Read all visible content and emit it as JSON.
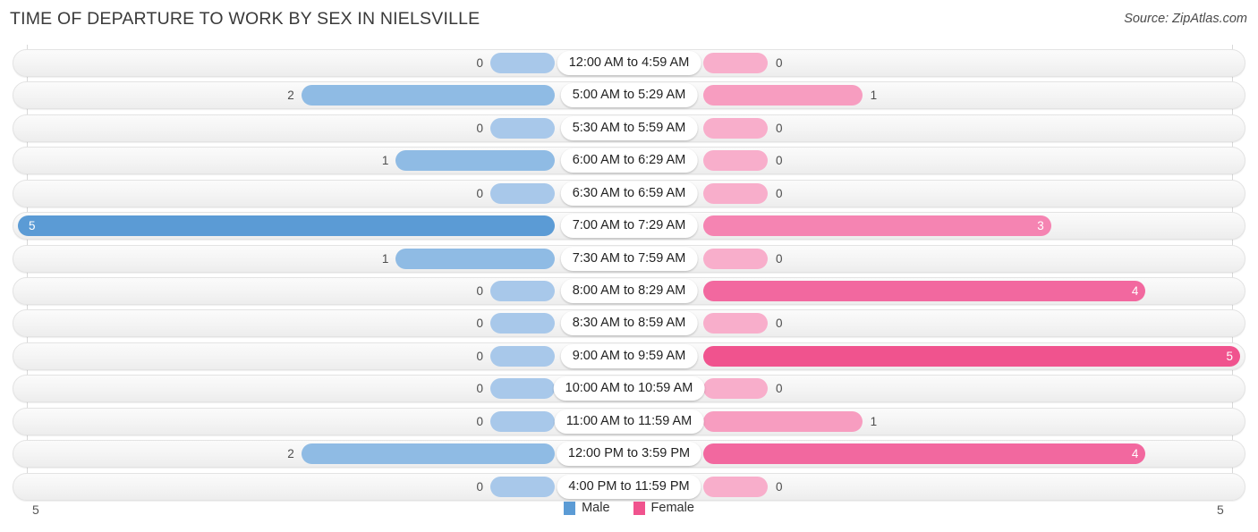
{
  "header": {
    "title": "TIME OF DEPARTURE TO WORK BY SEX IN NIELSVILLE",
    "source": "Source: ZipAtlas.com"
  },
  "axis": {
    "left_label": "5",
    "right_label": "5"
  },
  "legend": {
    "items": [
      {
        "label": "Male",
        "color": "#5b9bd5"
      },
      {
        "label": "Female",
        "color": "#f0538e"
      }
    ]
  },
  "colors": {
    "male_max": "#5b9bd5",
    "male_mid": "#8fbbe4",
    "male_low": "#a8c8ea",
    "male_zero": "#a8c8ea",
    "female_max": "#f0538e",
    "female_high": "#f2689f",
    "female_mid": "#f584b2",
    "female_low": "#f79dc0",
    "female_zero": "#f8aecb",
    "track": "#f4f4f4",
    "gridline": "#d8d8d8"
  },
  "chart_data": {
    "type": "bar",
    "subtype": "diverging-bidirectional",
    "title": "TIME OF DEPARTURE TO WORK BY SEX IN NIELSVILLE",
    "xlabel": "",
    "ylabel": "",
    "xlim": [
      5,
      5
    ],
    "axis_left_max": 5,
    "axis_right_max": 5,
    "grid": true,
    "legend_position": "bottom-center",
    "categories": [
      "12:00 AM to 4:59 AM",
      "5:00 AM to 5:29 AM",
      "5:30 AM to 5:59 AM",
      "6:00 AM to 6:29 AM",
      "6:30 AM to 6:59 AM",
      "7:00 AM to 7:29 AM",
      "7:30 AM to 7:59 AM",
      "8:00 AM to 8:29 AM",
      "8:30 AM to 8:59 AM",
      "9:00 AM to 9:59 AM",
      "10:00 AM to 10:59 AM",
      "11:00 AM to 11:59 AM",
      "12:00 PM to 3:59 PM",
      "4:00 PM to 11:59 PM"
    ],
    "series": [
      {
        "name": "Male",
        "side": "left",
        "values": [
          0,
          2,
          0,
          1,
          0,
          5,
          1,
          0,
          0,
          0,
          0,
          0,
          2,
          0
        ]
      },
      {
        "name": "Female",
        "side": "right",
        "values": [
          0,
          1,
          0,
          0,
          0,
          3,
          0,
          4,
          0,
          5,
          0,
          1,
          4,
          0
        ]
      }
    ]
  }
}
